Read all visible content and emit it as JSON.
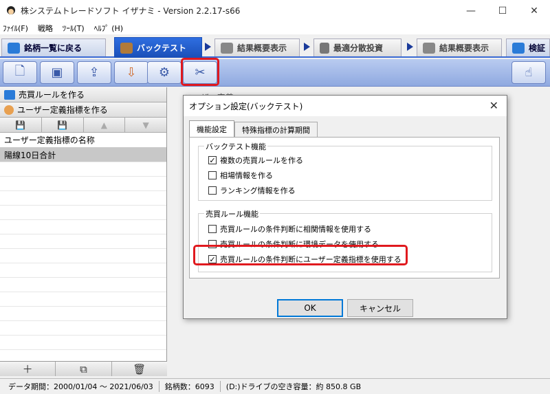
{
  "window": {
    "title": "株システムトレードソフト イザナミ - Version 2.2.17-s66",
    "minimize": "—",
    "maximize": "☐",
    "close": "✕"
  },
  "menu": [
    {
      "label": "ﾌｧｲﾙ(F)"
    },
    {
      "label": "戦略"
    },
    {
      "label": "ﾂｰﾙ(T)"
    },
    {
      "label": "ﾍﾙﾌﾟ (H)"
    }
  ],
  "tabs": {
    "home": "銘柄一覧に戻る",
    "backtest": "バックテスト",
    "summary": "結果概要表示",
    "portfolio": "最適分散投資",
    "summary2": "結果概要表示",
    "verify": "検証"
  },
  "left_panel": {
    "sell_rule": "売買ルールを作る",
    "user_indicator": "ユーザー定義指標を作る",
    "list_header": "ユーザー定義指標の名称",
    "items": [
      "陽線10日合計"
    ]
  },
  "right_area": {
    "title": "ユーザー定義"
  },
  "dialog": {
    "title": "オプション設定(バックテスト)",
    "close": "✕",
    "tabs": [
      "機能設定",
      "特殊指標の計算期間"
    ],
    "group1": {
      "label": "バックテスト機能",
      "options": [
        {
          "label": "複数の売買ルールを作る",
          "checked": true
        },
        {
          "label": "相場情報を作る",
          "checked": false
        },
        {
          "label": "ランキング情報を作る",
          "checked": false
        }
      ]
    },
    "group2": {
      "label": "売買ルール機能",
      "options": [
        {
          "label": "売買ルールの条件判断に相関情報を使用する",
          "checked": false
        },
        {
          "label": "売買ルールの条件判断に環境データを使用する",
          "checked": false
        },
        {
          "label": "売買ルールの条件判断にユーザー定義指標を使用する",
          "checked": true
        }
      ]
    },
    "ok": "OK",
    "cancel": "キャンセル"
  },
  "status": {
    "period": "データ期間：2000/01/04 〜 2021/06/03",
    "count": "銘柄数：6093",
    "disk": "(D:)ドライブの空き容量：約 850.8 GB"
  },
  "colors": {
    "accent": "#1a4fb8",
    "highlight": "#e0191e"
  }
}
